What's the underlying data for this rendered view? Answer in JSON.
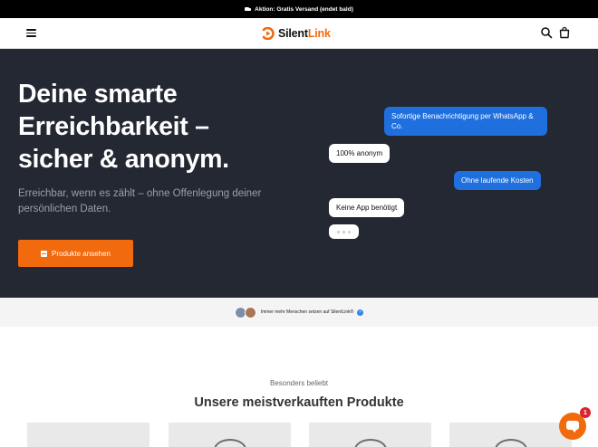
{
  "announcement": {
    "text": "Aktion: Gratis Versand (endet bald)",
    "icon": "truck-icon"
  },
  "header": {
    "logo": {
      "part1": "Silent",
      "part2": "Link",
      "accent": "#f26a0e"
    },
    "menu_icon": "hamburger-menu-icon",
    "search_icon": "search-icon",
    "cart_icon": "shopping-bag-icon"
  },
  "hero": {
    "title": "Deine smarte Erreichbarkeit – sicher & anonym.",
    "subtitle": "Erreichbar, wenn es zählt – ohne Offenlegung deiner persönlichen Daten.",
    "cta_label": "Produkte ansehen",
    "background": "#232833",
    "chat": [
      {
        "from": "outgoing",
        "text": "Sofortige Benachrichtigung per WhatsApp & Co."
      },
      {
        "from": "incoming",
        "text": "100% anonym"
      },
      {
        "from": "outgoing",
        "text": "Ohne laufende Kosten"
      },
      {
        "from": "incoming",
        "text": "Keine App benötigt"
      }
    ]
  },
  "trust_bar": {
    "text": "Immer mehr Menschen setzen auf SilentLink®",
    "verified_icon": "verified-check-icon"
  },
  "products": {
    "eyebrow": "Besonders beliebt",
    "title": "Unsere meistverkauften Produkte",
    "card_count_visible": 4
  },
  "chat_widget": {
    "badge": "1",
    "icon": "chat-bubble-icon"
  },
  "colors": {
    "brand_orange": "#f26a0e",
    "bubble_blue": "#1f6fde"
  }
}
